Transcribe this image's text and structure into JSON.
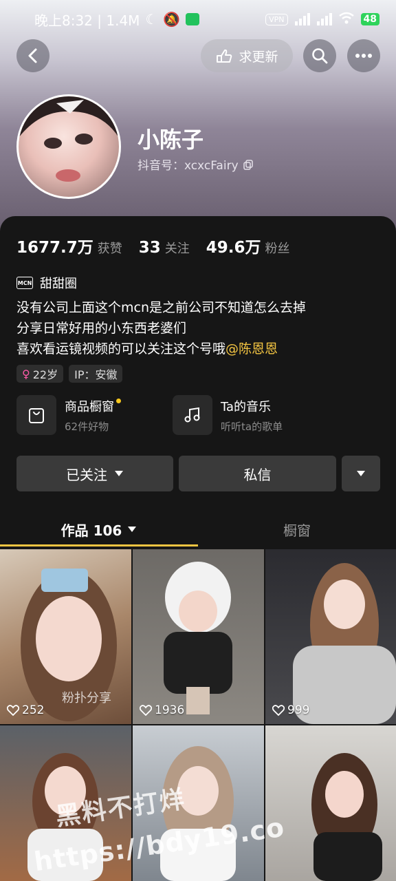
{
  "status_bar": {
    "time": "晚上8:32 | 1.4M",
    "vpn": "VPN",
    "battery": "48"
  },
  "header": {
    "request_update_label": "求更新"
  },
  "profile": {
    "name": "小陈子",
    "douyin_id": "抖音号：xcxcFairy"
  },
  "stats": [
    {
      "num": "1677.7万",
      "label": "获赞"
    },
    {
      "num": "33",
      "label": "关注"
    },
    {
      "num": "49.6万",
      "label": "粉丝"
    }
  ],
  "mcn": {
    "badge": "MCN",
    "name": "甜甜圈"
  },
  "bio": {
    "line1": "没有公司上面这个mcn是之前公司不知道怎么去掉",
    "line2": "分享日常好用的小东西老婆们",
    "line3_prefix": "喜欢看运镜视频的可以关注这个号哦",
    "line3_mention": "@陈恩恩"
  },
  "tags": {
    "age": "22岁",
    "ip": "IP：安徽"
  },
  "features": {
    "shop": {
      "title": "商品橱窗",
      "subtitle": "62件好物"
    },
    "music": {
      "title": "Ta的音乐",
      "subtitle": "听听ta的歌单"
    }
  },
  "actions": {
    "followed": "已关注",
    "message": "私信"
  },
  "tabs": {
    "works": "作品 106",
    "showcase": "橱窗"
  },
  "videos": [
    {
      "likes": "252",
      "caption": "粉扑分享"
    },
    {
      "likes": "1936"
    },
    {
      "likes": "999"
    },
    {},
    {},
    {}
  ],
  "watermark": {
    "line1": "黑料不打烊",
    "line2": "https://bdy19.co"
  }
}
